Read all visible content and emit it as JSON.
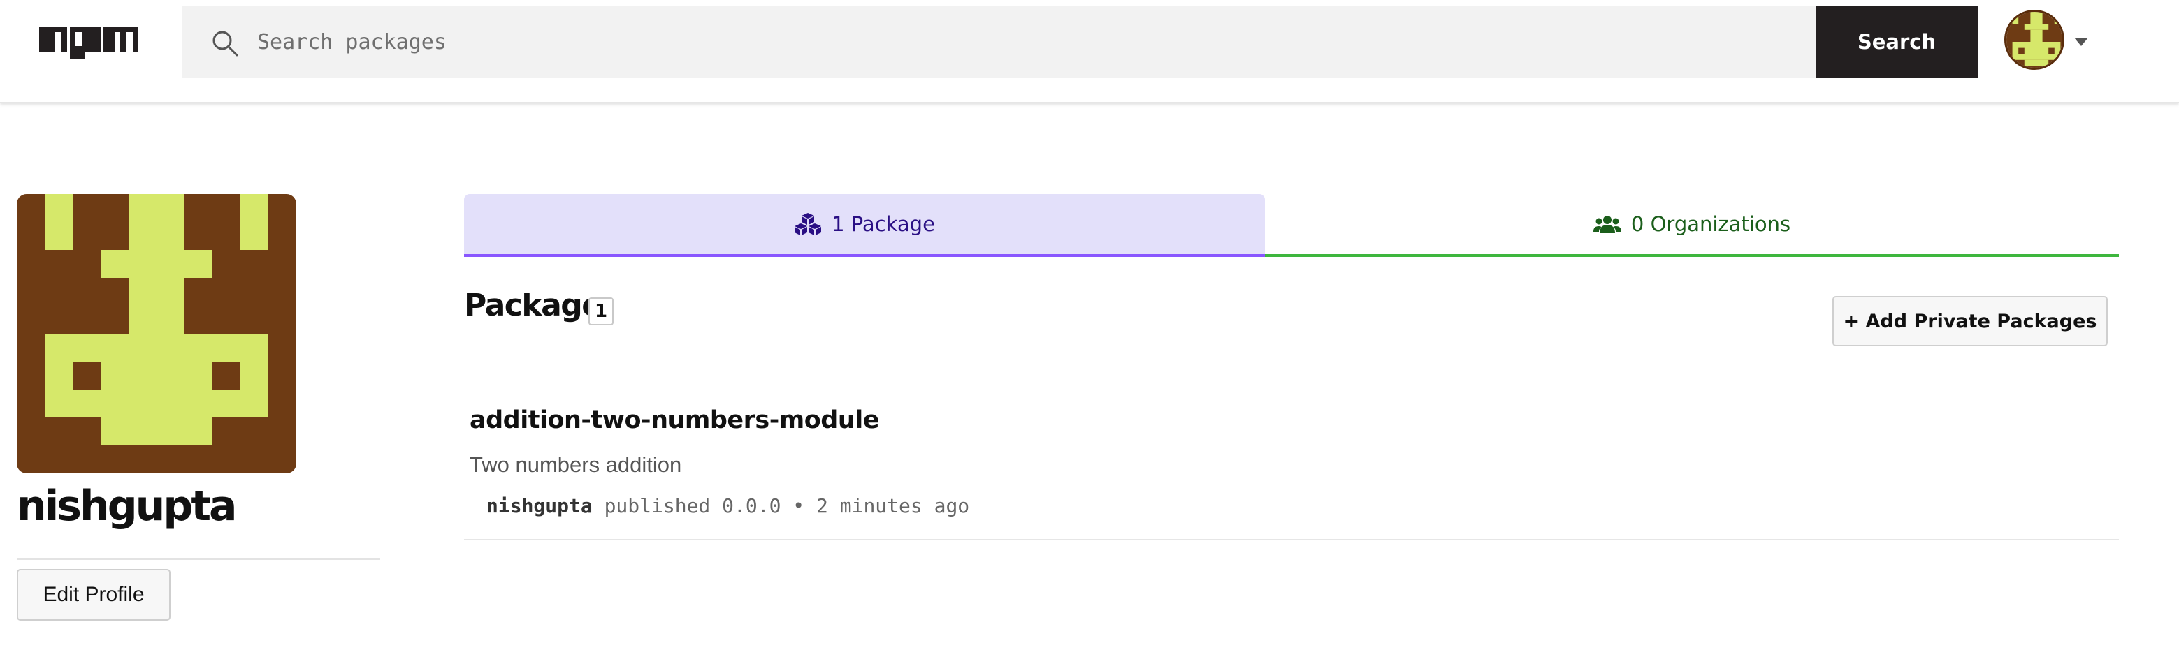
{
  "header": {
    "logo": "npm",
    "search_placeholder": "Search packages",
    "search_button": "Search"
  },
  "profile": {
    "username": "nishgupta",
    "edit_profile": "Edit Profile"
  },
  "tabs": [
    {
      "label": "1 Package",
      "icon": "packages-icon",
      "active": true
    },
    {
      "label": "0 Organizations",
      "icon": "users-icon",
      "active": false
    }
  ],
  "packages_section": {
    "title": "Package",
    "count": "1",
    "add_private": "+ Add Private Packages"
  },
  "packages": [
    {
      "name": "addition-two-numbers-module",
      "description": "Two numbers addition",
      "author": "nishgupta",
      "meta": " published 0.0.0 • 2 minutes ago"
    }
  ],
  "colors": {
    "avatar_bg": "#6e3b14",
    "avatar_fg": "#d6e86a",
    "tab_packages_bg": "#e3e0fa",
    "tab_packages_accent": "#8956ff",
    "tab_orgs_accent": "#3eb63e",
    "search_button_bg": "#231f20"
  }
}
